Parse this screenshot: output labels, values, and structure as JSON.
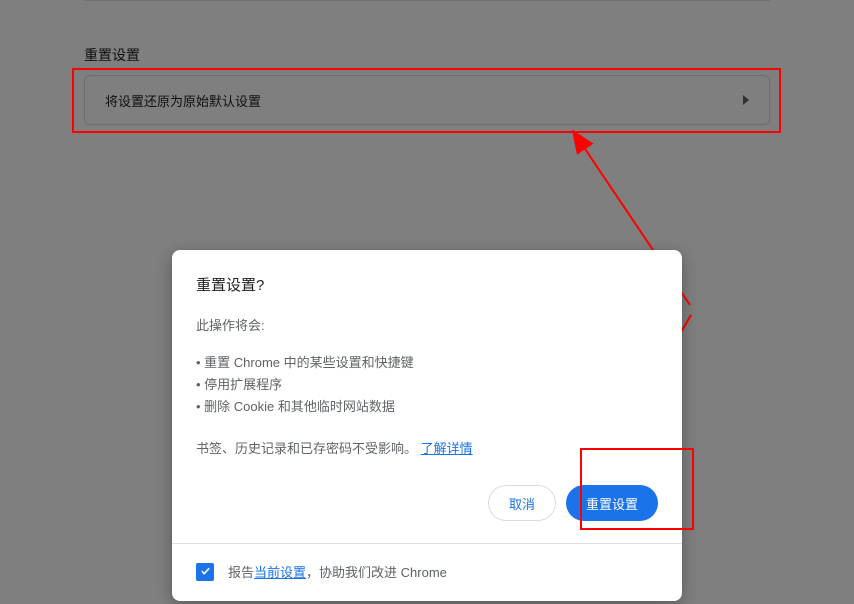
{
  "section": {
    "title": "重置设置",
    "reset_row_label": "将设置还原为原始默认设置"
  },
  "dialog": {
    "title": "重置设置?",
    "subtitle": "此操作将会:",
    "bullets": [
      "• 重置 Chrome 中的某些设置和快捷键",
      "• 停用扩展程序",
      "• 删除 Cookie 和其他临时网站数据"
    ],
    "note_prefix": "书签、历史记录和已存密码不受影响。",
    "learn_more": "了解详情",
    "cancel": "取消",
    "confirm": "重置设置",
    "checkbox_prefix": "报告",
    "checkbox_link": "当前设置",
    "checkbox_suffix": "，协助我们改进 Chrome"
  }
}
